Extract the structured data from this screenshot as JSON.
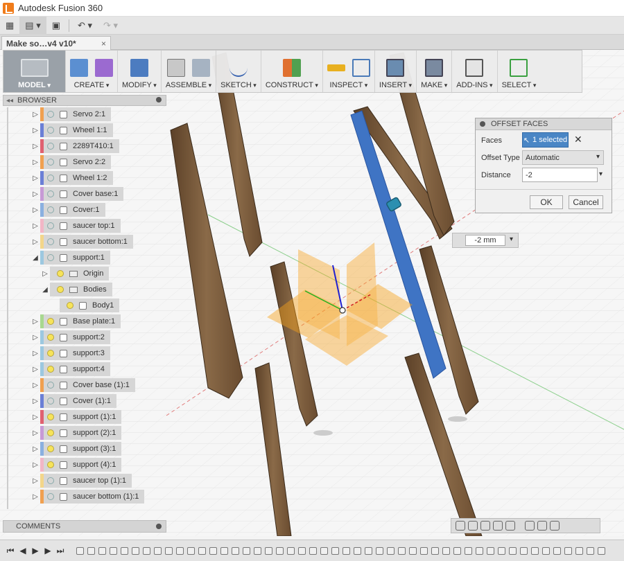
{
  "window": {
    "title": "Autodesk Fusion 360"
  },
  "document_tab": {
    "label": "Make so…v4 v10*",
    "close": "×"
  },
  "toolbar": {
    "groups": [
      {
        "label": "MODEL"
      },
      {
        "label": "CREATE"
      },
      {
        "label": "MODIFY"
      },
      {
        "label": "ASSEMBLE"
      },
      {
        "label": "SKETCH"
      },
      {
        "label": "CONSTRUCT"
      },
      {
        "label": "INSPECT"
      },
      {
        "label": "INSERT"
      },
      {
        "label": "MAKE"
      },
      {
        "label": "ADD-INS"
      },
      {
        "label": "SELECT"
      }
    ]
  },
  "browser": {
    "title": "BROWSER",
    "items": [
      {
        "name": "Servo 2:1",
        "expand": "▷",
        "color": "#f0a050",
        "bulb": "off",
        "icon": "box"
      },
      {
        "name": "Wheel 1:1",
        "expand": "▷",
        "color": "#6a7fd6",
        "bulb": "off",
        "icon": "box"
      },
      {
        "name": "2289T410:1",
        "expand": "▷",
        "color": "#e06070",
        "bulb": "off",
        "icon": "box"
      },
      {
        "name": "Servo 2:2",
        "expand": "▷",
        "color": "#f0a050",
        "bulb": "off",
        "icon": "box"
      },
      {
        "name": "Wheel 1:2",
        "expand": "▷",
        "color": "#6a7fd6",
        "bulb": "off",
        "icon": "box"
      },
      {
        "name": "Cover base:1",
        "expand": "▷",
        "color": "#c79ad6",
        "bulb": "off",
        "icon": "box"
      },
      {
        "name": "Cover:1",
        "expand": "▷",
        "color": "#8ab0e0",
        "bulb": "off",
        "icon": "box"
      },
      {
        "name": "saucer top:1",
        "expand": "▷",
        "color": "#f2b6c6",
        "bulb": "off",
        "icon": "box"
      },
      {
        "name": "saucer bottom:1",
        "expand": "▷",
        "color": "#f3d68a",
        "bulb": "off",
        "icon": "box"
      },
      {
        "name": "support:1",
        "expand": "◢",
        "color": "#9cc8e0",
        "bulb": "off",
        "icon": "box"
      },
      {
        "name": "Origin",
        "expand": "▷",
        "color": "",
        "bulb": "on",
        "icon": "folder",
        "indent": 1
      },
      {
        "name": "Bodies",
        "expand": "◢",
        "color": "",
        "bulb": "on",
        "icon": "folder",
        "indent": 1
      },
      {
        "name": "Body1",
        "expand": "",
        "color": "",
        "bulb": "on",
        "icon": "box",
        "indent": 2
      },
      {
        "name": "Base plate:1",
        "expand": "▷",
        "color": "#a8d890",
        "bulb": "on",
        "icon": "box"
      },
      {
        "name": "support:2",
        "expand": "▷",
        "color": "#9cc8e0",
        "bulb": "on",
        "icon": "box"
      },
      {
        "name": "support:3",
        "expand": "▷",
        "color": "#9cc8e0",
        "bulb": "on",
        "icon": "box"
      },
      {
        "name": "support:4",
        "expand": "▷",
        "color": "#9cc8e0",
        "bulb": "on",
        "icon": "box"
      },
      {
        "name": "Cover base (1):1",
        "expand": "▷",
        "color": "#f0a050",
        "bulb": "off",
        "icon": "box"
      },
      {
        "name": "Cover (1):1",
        "expand": "▷",
        "color": "#6a7fd6",
        "bulb": "off",
        "icon": "box"
      },
      {
        "name": "support (1):1",
        "expand": "▷",
        "color": "#e06070",
        "bulb": "on",
        "icon": "box"
      },
      {
        "name": "support (2):1",
        "expand": "▷",
        "color": "#c79ad6",
        "bulb": "on",
        "icon": "box"
      },
      {
        "name": "support (3):1",
        "expand": "▷",
        "color": "#8ab0e0",
        "bulb": "on",
        "icon": "box"
      },
      {
        "name": "support (4):1",
        "expand": "▷",
        "color": "#f2b6c6",
        "bulb": "on",
        "icon": "box"
      },
      {
        "name": "saucer top (1):1",
        "expand": "▷",
        "color": "#f3d68a",
        "bulb": "off",
        "icon": "box"
      },
      {
        "name": "saucer bottom (1):1",
        "expand": "▷",
        "color": "#f0a050",
        "bulb": "off",
        "icon": "box"
      }
    ]
  },
  "dialog": {
    "title": "OFFSET FACES",
    "faces_label": "Faces",
    "faces_value": "1 selected",
    "clear": "✕",
    "offset_type_label": "Offset Type",
    "offset_type_value": "Automatic",
    "distance_label": "Distance",
    "distance_value": "-2",
    "ok": "OK",
    "cancel": "Cancel"
  },
  "manipulator": {
    "value": "-2 mm"
  },
  "comments": {
    "title": "COMMENTS"
  },
  "colors": {
    "selection": "#4a86c5",
    "wood": "#7a5a3a",
    "plane": "#f7a21b"
  }
}
